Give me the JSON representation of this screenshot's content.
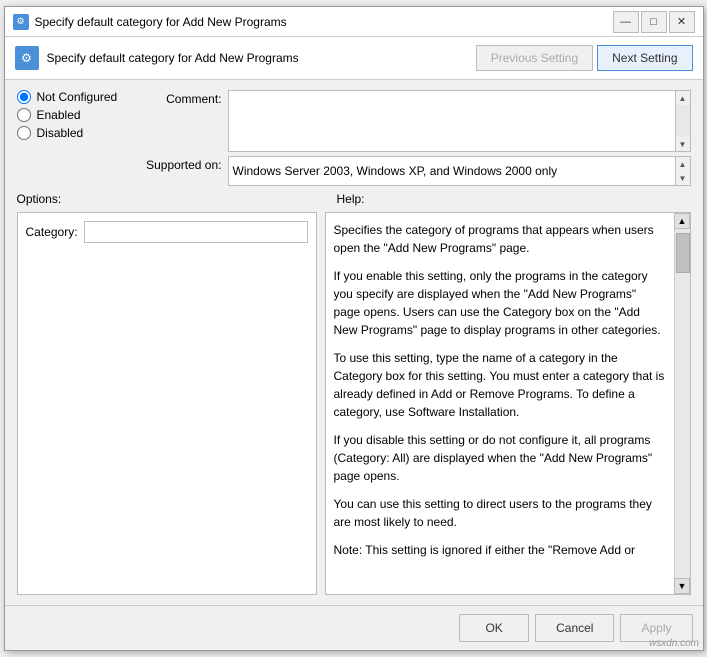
{
  "window": {
    "title": "Specify default category for Add New Programs",
    "title_icon": "⚙",
    "min_btn": "—",
    "max_btn": "□",
    "close_btn": "✕"
  },
  "header": {
    "title": "Specify default category for Add New Programs",
    "icon": "⚙",
    "prev_btn": "Previous Setting",
    "next_btn": "Next Setting"
  },
  "radio": {
    "not_configured": "Not Configured",
    "enabled": "Enabled",
    "disabled": "Disabled"
  },
  "comment": {
    "label": "Comment:",
    "value": ""
  },
  "supported": {
    "label": "Supported on:",
    "value": "Windows Server 2003, Windows XP, and Windows 2000 only"
  },
  "sections": {
    "options_label": "Options:",
    "help_label": "Help:"
  },
  "options": {
    "category_label": "Category:",
    "category_value": ""
  },
  "help": {
    "paragraphs": [
      "Specifies the category of programs that appears when users open the \"Add New Programs\" page.",
      "If you enable this setting, only the programs in the category you specify are displayed when the \"Add New Programs\" page opens. Users can use the Category box on the \"Add New Programs\" page to display programs in other categories.",
      "To use this setting, type the name of a category in the Category box for this setting. You must enter a category that is already defined in Add or Remove Programs. To define a category, use Software Installation.",
      "If you disable this setting or do not configure it, all programs (Category: All) are displayed when the \"Add New Programs\" page opens.",
      "You can use this setting to direct users to the programs they are most likely to need.",
      "Note: This setting is ignored if either the \"Remove Add or"
    ]
  },
  "footer": {
    "ok_label": "OK",
    "cancel_label": "Cancel",
    "apply_label": "Apply"
  },
  "watermark": "wsxdn.com"
}
